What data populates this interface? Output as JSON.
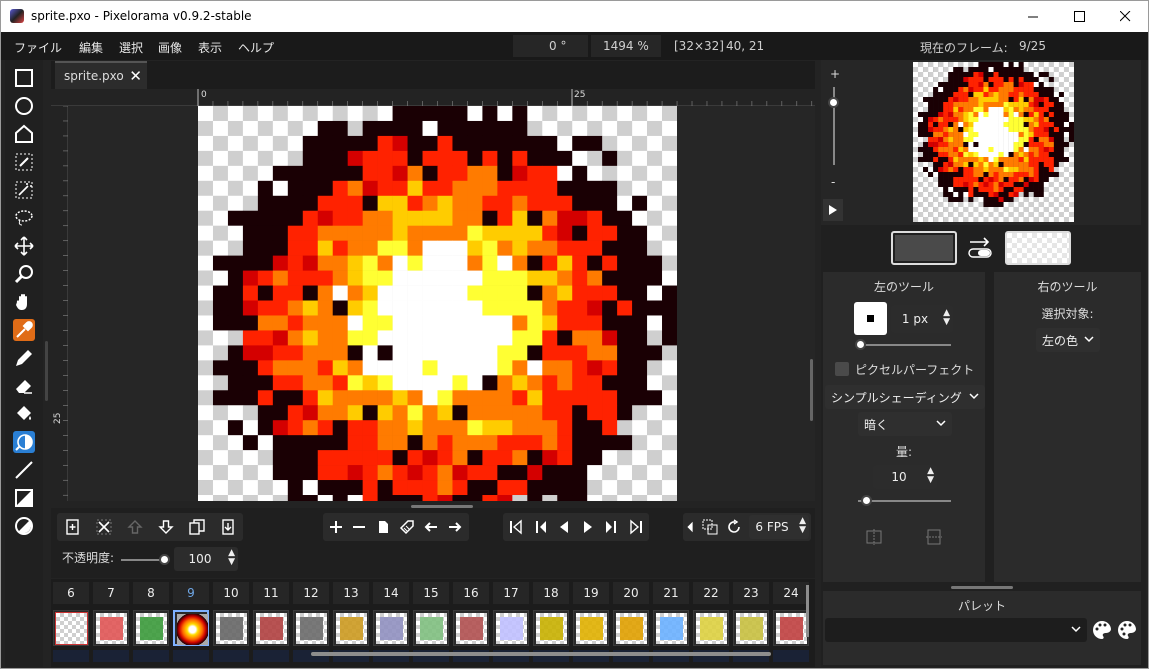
{
  "window": {
    "title": "sprite.pxo - Pixelorama v0.9.2-stable",
    "controls": {
      "minimize": "—",
      "maximize": "☐",
      "close": "✕"
    }
  },
  "menu": [
    "ファイル",
    "編集",
    "選択",
    "画像",
    "表示",
    "ヘルプ"
  ],
  "status": {
    "rotation": "0 °",
    "zoom": "1494 %",
    "size": "[32×32]",
    "coords": "40, 21",
    "current_frame_label": "現在のフレーム:",
    "current_frame_value": "9/25"
  },
  "tools": [
    "rectangle-select",
    "ellipse-select",
    "polygon-select",
    "color-select",
    "magic-wand",
    "lasso",
    "move",
    "zoom",
    "pan",
    "color-picker",
    "pencil",
    "eraser",
    "bucket",
    "shading",
    "line",
    "rectangle",
    "ellipse"
  ],
  "tab": {
    "label": "sprite.pxo",
    "close": "✕"
  },
  "rulers": {
    "h_labels": [
      "0",
      "25"
    ],
    "v_labels": [
      "25"
    ]
  },
  "animation": {
    "opacity_label": "不透明度:",
    "opacity_value": "100",
    "opacity": 1.0,
    "fps": "6 FPS"
  },
  "frames": {
    "numbers": [
      "6",
      "7",
      "8",
      "9",
      "10",
      "11",
      "12",
      "13",
      "14",
      "15",
      "16",
      "17",
      "18",
      "19",
      "20",
      "21",
      "22",
      "23",
      "24"
    ],
    "current": "9"
  },
  "preview": {
    "zoom_plus": "+",
    "zoom_minus": "-",
    "zoom_level": 0.8
  },
  "left_tool": {
    "title": "左のツール",
    "brush_size": "1 px",
    "brush_size_fraction": 0.0,
    "pixel_perfect_label": "ピクセルパーフェクト",
    "pixel_perfect_checked": false,
    "shading_mode": "シンプルシェーディング",
    "shade_direction": "暗く",
    "amount_label": "量:",
    "amount_value": "10",
    "amount_fraction": 0.1
  },
  "right_tool": {
    "title": "右のツール",
    "target_label": "選択対象:",
    "target_value": "左の色"
  },
  "palette": {
    "title": "パレット"
  },
  "colors": {
    "left_color": "#4a4a4a",
    "accent_left": "#2a7fd4",
    "accent_right": "#e06c17",
    "current_frame": "#6fa7e6"
  }
}
